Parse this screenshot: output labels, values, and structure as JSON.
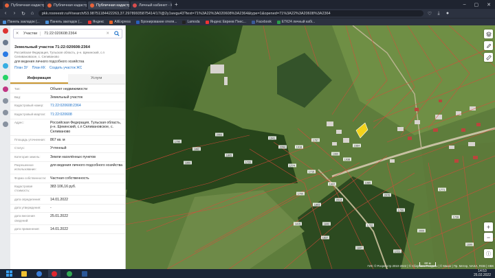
{
  "browser": {
    "tabs": [
      {
        "title": "Публичная кадастровая с...",
        "color": "#e8633a"
      },
      {
        "title": "Публичная кадастровая с...",
        "color": "#e8633a"
      },
      {
        "title": "Публичная кадастровая с...",
        "color": "#e8633a"
      },
      {
        "title": "Личный кабинет - Кадас...",
        "color": "#d94d4d"
      }
    ],
    "url": "pkk.rosreestr.ru/#/search/53.98751184422263,37.29789935875414/17/@2y1wvgu43?text=71%3A22%3A020608%3A2364&type=1&opened=71%3A22%3A20608%3A2364",
    "bookmarks": [
      {
        "label": "Панель закладок (...",
        "color": "#4a90d9"
      },
      {
        "label": "Панель закладок (...",
        "color": "#4a90d9"
      },
      {
        "label": "Яндекс",
        "color": "#e33"
      },
      {
        "label": "AliExpress",
        "color": "#e8632a"
      },
      {
        "label": "Бронирование отеля...",
        "color": "#2a5fb8"
      },
      {
        "label": "Lamoda",
        "color": "#222"
      },
      {
        "label": "Яндекс Евреев Пнес...",
        "color": "#e33"
      },
      {
        "label": "Facebook",
        "color": "#3b5998"
      },
      {
        "label": "ЕТК24 личный кабі...",
        "color": "#2a9d4a"
      }
    ]
  },
  "search": {
    "type": "Участки",
    "value": "71:22:020608:2364"
  },
  "parcel": {
    "title": "Земельный участок 71:22:020608:2364",
    "address_short": "Российская Федерация, Тульская область, р-н. Щекинский, с.п Селивановское, с. Селиваново",
    "usage": "для ведения личного подсобного хозяйства",
    "links": [
      "План ЗУ",
      "План КК",
      "Создать участок ЖС"
    ]
  },
  "tabs": [
    "Информация",
    "Услуги"
  ],
  "rows": [
    {
      "k": "Тип:",
      "v": "Объект недвижимости",
      "link": false
    },
    {
      "k": "Вид:",
      "v": "Земельный участок",
      "link": false
    },
    {
      "k": "Кадастровый номер:",
      "v": "71:22:020608:2364",
      "link": true
    },
    {
      "k": "Кадастровый квартал:",
      "v": "71:22:020608",
      "link": true
    },
    {
      "k": "Адрес:",
      "v": "Российская Федерация, Тульская область, р-н. Щекинский, с.п Селивановское, с. Селиваново",
      "link": false
    },
    {
      "k": "Площадь уточненная:",
      "v": "867 кв. м",
      "link": false
    },
    {
      "k": "Статус:",
      "v": "Учтенный",
      "link": false
    },
    {
      "k": "Категория земель:",
      "v": "Земли населённых пунктов",
      "link": false
    },
    {
      "k": "Разрешенное использование:",
      "v": "для ведения личного подсобного хозяйства",
      "link": false
    },
    {
      "k": "Форма собственности:",
      "v": "Частная собственность",
      "link": false
    },
    {
      "k": "Кадастровая стоимость:",
      "v": "383 106,16 руб.",
      "link": false
    },
    {
      "k": "дата определения:",
      "v": "14.01.2022",
      "link": false
    },
    {
      "k": "дата утверждения:",
      "v": "-",
      "link": false
    },
    {
      "k": "дата внесения сведений:",
      "v": "25.01.2022",
      "link": false
    },
    {
      "k": "дата применения:",
      "v": "14.01.2022",
      "link": false
    }
  ],
  "map": {
    "scale": "60 м",
    "attribution": "ГИС © Росреестр 2010-2022 | © Сбербанк Ресурсы | © Maxar | Пр. Метер, NASA, RGB | НВК",
    "parcel_labels": [
      "1790",
      "1862",
      "1859",
      "2063",
      "1805",
      "1720",
      "1941",
      "2264",
      "1918",
      "1767",
      "1960",
      "1938",
      "2364",
      "1774",
      "1715",
      "1902",
      "1700",
      "1893",
      "2014",
      "1985",
      "1815",
      "1842",
      "1722",
      "1837",
      "1847",
      "2076",
      "1706",
      "2009",
      "1771",
      "1728",
      "1699",
      "1721"
    ],
    "highlight_color": "#f2d21b"
  },
  "taskbar": {
    "time": "14:53",
    "date": "25.02.2022"
  }
}
